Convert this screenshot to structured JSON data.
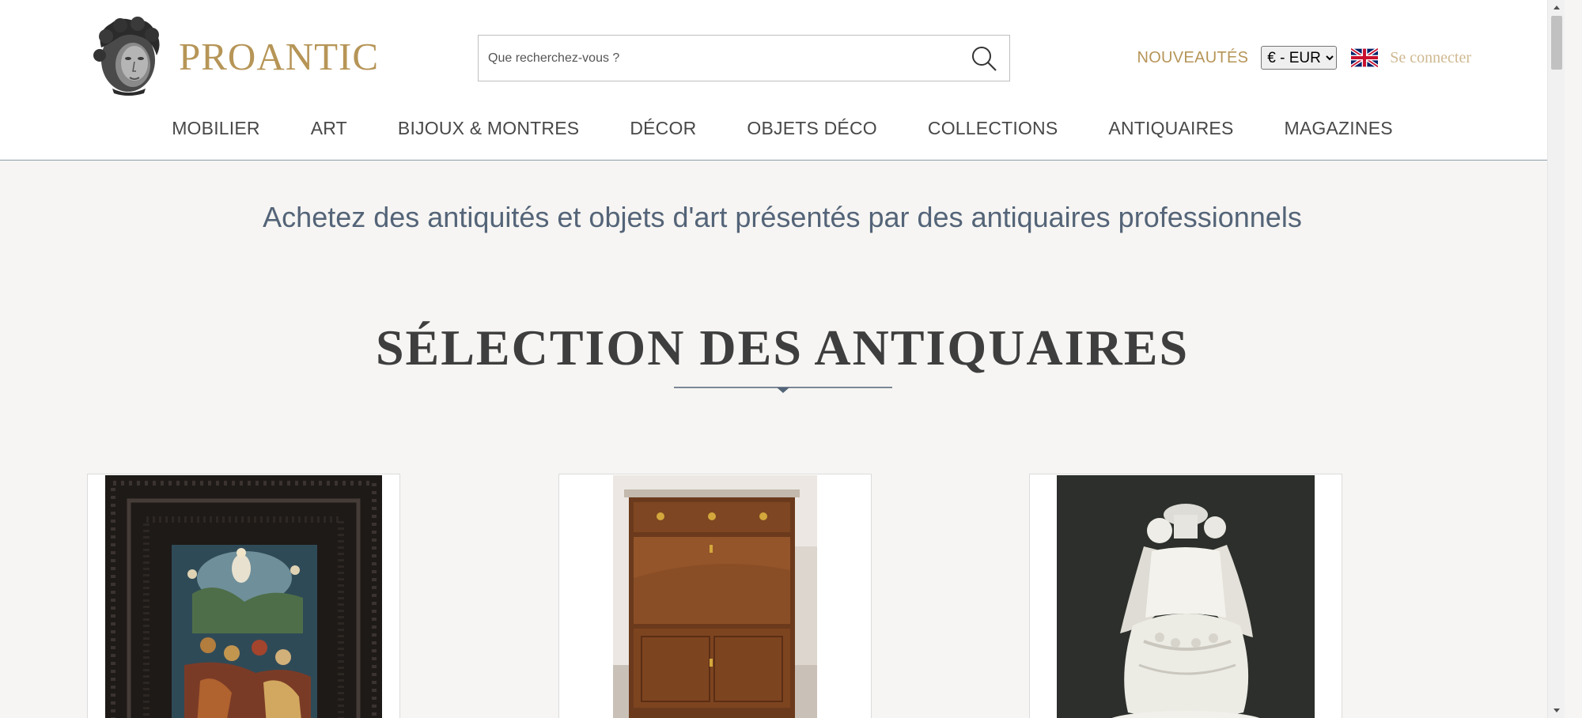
{
  "header": {
    "logo_text": "PROANTIC",
    "search": {
      "placeholder": "Que recherchez-vous ?",
      "value": ""
    },
    "news_label": "NOUVEAUTÉS",
    "currency": {
      "selected": "€ - EUR",
      "options": [
        "€ - EUR"
      ]
    },
    "language_flag": "uk-flag-icon",
    "login_label": "Se connecter"
  },
  "nav": {
    "items": [
      {
        "label": "MOBILIER"
      },
      {
        "label": "ART"
      },
      {
        "label": "BIJOUX & MONTRES"
      },
      {
        "label": "DÉCOR"
      },
      {
        "label": "OBJETS DÉCO"
      },
      {
        "label": "COLLECTIONS"
      },
      {
        "label": "ANTIQUAIRES"
      },
      {
        "label": "MAGAZINES"
      }
    ]
  },
  "main": {
    "tagline": "Achetez des antiquités et objets d'art présentés par des antiquaires professionnels",
    "section_title": "SÉLECTION DES ANTIQUAIRES",
    "cards": [
      {
        "image_icon": "framed-religious-painting-icon"
      },
      {
        "image_icon": "wooden-secretary-cabinet-icon"
      },
      {
        "image_icon": "marble-sculpture-icon"
      }
    ]
  },
  "colors": {
    "brand_gold": "#b69557",
    "login_gold": "#cfb991",
    "tagline_blue": "#546478",
    "page_bg": "#f6f5f3",
    "header_border": "#8e9cab"
  }
}
